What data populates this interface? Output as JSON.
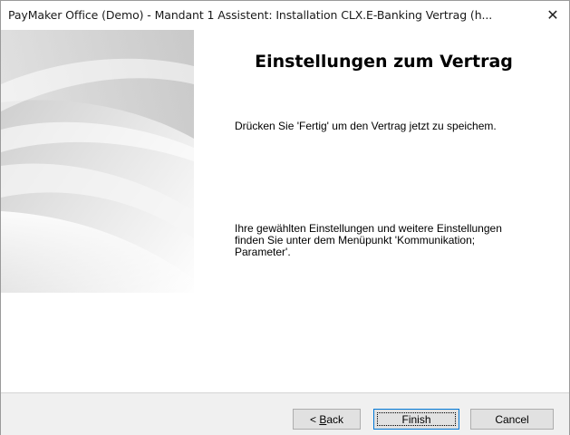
{
  "window": {
    "title": "PayMaker Office (Demo) - Mandant 1 Assistent: Installation CLX.E-Banking Vertrag (h...",
    "close_label": "✕"
  },
  "main": {
    "heading": "Einstellungen zum Vertrag",
    "paragraph1": "Drücken Sie 'Fertig' um den Vertrag jetzt zu speichem.",
    "paragraph2": "Ihre gewählten Einstellungen und weitere Einstellungen finden Sie unter dem Menüpunkt 'Kommunikation; Parameter'."
  },
  "footer": {
    "back_prefix": "< ",
    "back_mnemonic": "B",
    "back_rest": "ack",
    "finish_label": "Finish",
    "cancel_label": "Cancel"
  },
  "colors": {
    "accent_focus": "#0078d7",
    "footer_bg": "#f0f0f0",
    "button_bg": "#e1e1e1"
  }
}
